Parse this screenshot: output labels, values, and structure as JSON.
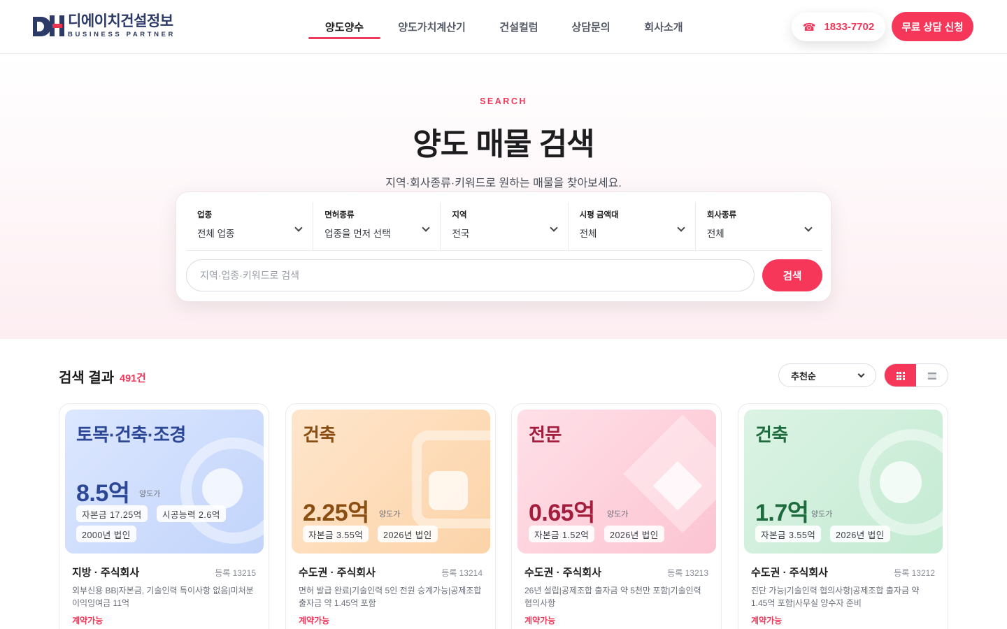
{
  "header": {
    "logo_title": "디에이치건설정보",
    "logo_sub": "BUSINESS PARTNER",
    "nav": [
      {
        "label": "양도양수",
        "active": true
      },
      {
        "label": "양도가치계산기",
        "active": false
      },
      {
        "label": "건설컬럼",
        "active": false
      },
      {
        "label": "상담문의",
        "active": false
      },
      {
        "label": "회사소개",
        "active": false
      }
    ],
    "phone_icon": "☎",
    "phone": "1833-7702",
    "cta": "무료 상담 신청"
  },
  "hero": {
    "eyebrow": "SEARCH",
    "title": "양도 매물 검색",
    "desc": "지역·회사종류·키워드로 원하는 매물을 찾아보세요."
  },
  "search": {
    "filters": [
      {
        "label": "업종",
        "value": "전체 업종"
      },
      {
        "label": "면허종류",
        "value": "업종을 먼저 선택"
      },
      {
        "label": "지역",
        "value": "전국"
      },
      {
        "label": "시평 금액대",
        "value": "전체"
      },
      {
        "label": "회사종류",
        "value": "전체"
      }
    ],
    "placeholder": "지역·업종·키워드로 검색",
    "button": "검색"
  },
  "results": {
    "title": "검색 결과",
    "count": "491건",
    "sort": "추천순"
  },
  "colors": {
    "accent": "#f7375a",
    "navy": "#2b3a67"
  },
  "cards": [
    {
      "category": "토목·건축·조경",
      "price": "8.5억",
      "price_label": "양도가",
      "tags": [
        "자본금 17.25억",
        "시공능력 2.6억",
        "2000년 법인"
      ],
      "region": "지방 · 주식회사",
      "reg": "등록 13215",
      "desc": "외부신용 BB|자본금, 기술인력 특이사항 없음|미처분 이익잉여금 11억",
      "status": "계약가능"
    },
    {
      "category": "건축",
      "price": "2.25억",
      "price_label": "양도가",
      "tags": [
        "자본금 3.55억",
        "2026년 법인"
      ],
      "region": "수도권 · 주식회사",
      "reg": "등록 13214",
      "desc": "면허 발급 완료|기술인력 5인 전원 승계가능|공제조합 출자금 약 1.45억 포함",
      "status": "계약가능"
    },
    {
      "category": "전문",
      "price": "0.65억",
      "price_label": "양도가",
      "tags": [
        "자본금 1.52억",
        "2026년 법인"
      ],
      "region": "수도권 · 주식회사",
      "reg": "등록 13213",
      "desc": "26년 설립|공제조합 출자금 약 5천만 포함|기술인력 협의사항",
      "status": "계약가능"
    },
    {
      "category": "건축",
      "price": "1.7억",
      "price_label": "양도가",
      "tags": [
        "자본금 3.55억",
        "2026년 법인"
      ],
      "region": "수도권 · 주식회사",
      "reg": "등록 13212",
      "desc": "진단 가능|기술인력 협의사항|공제조합 출자금 약 1.45억 포함|사무실 양수자 준비",
      "status": "계약가능"
    }
  ]
}
